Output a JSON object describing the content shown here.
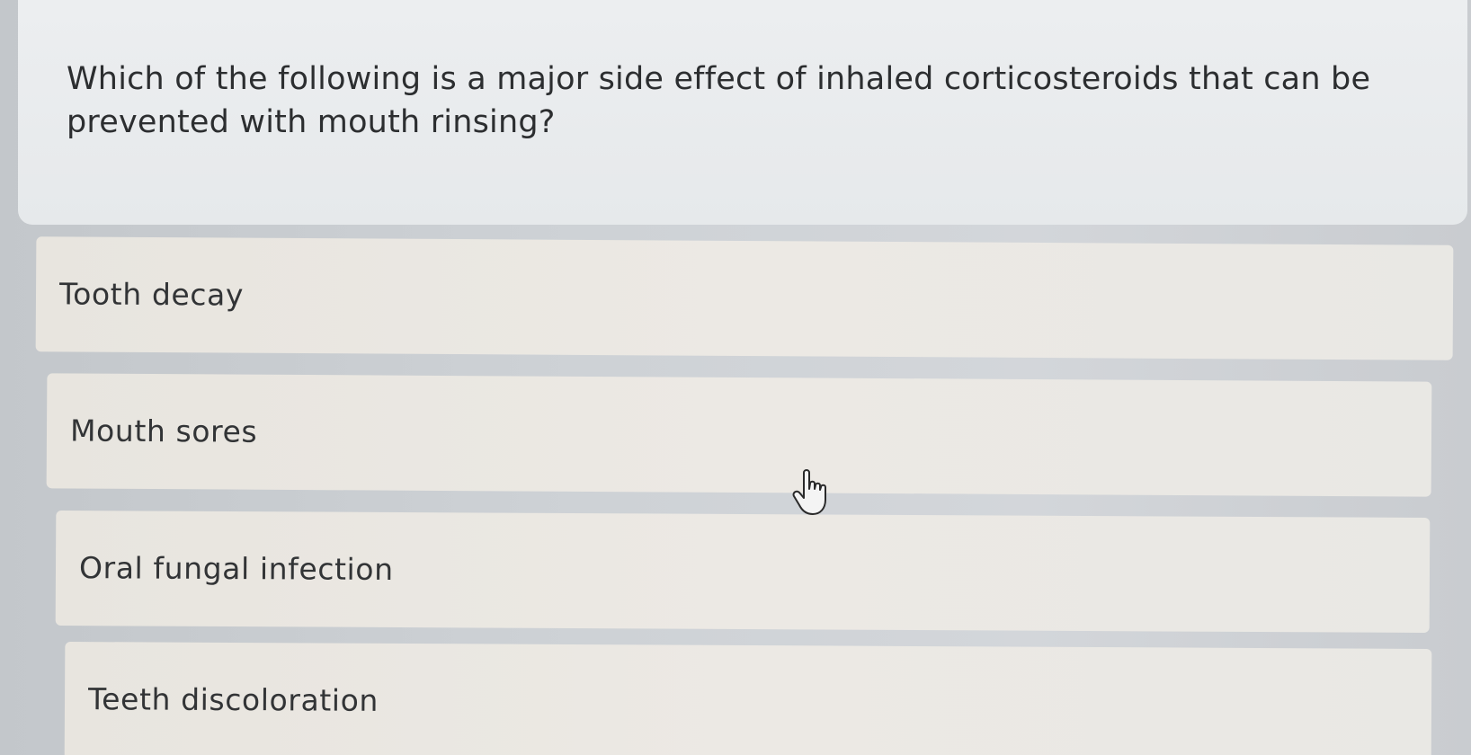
{
  "question": {
    "text": "Which of the following is a major side effect of inhaled corticosteroids that can be prevented with mouth rinsing?"
  },
  "options": [
    {
      "label": "Tooth decay"
    },
    {
      "label": "Mouth sores"
    },
    {
      "label": "Oral fungal infection"
    },
    {
      "label": "Teeth discoloration"
    }
  ],
  "cursor": {
    "icon": "hand-pointer-icon"
  }
}
